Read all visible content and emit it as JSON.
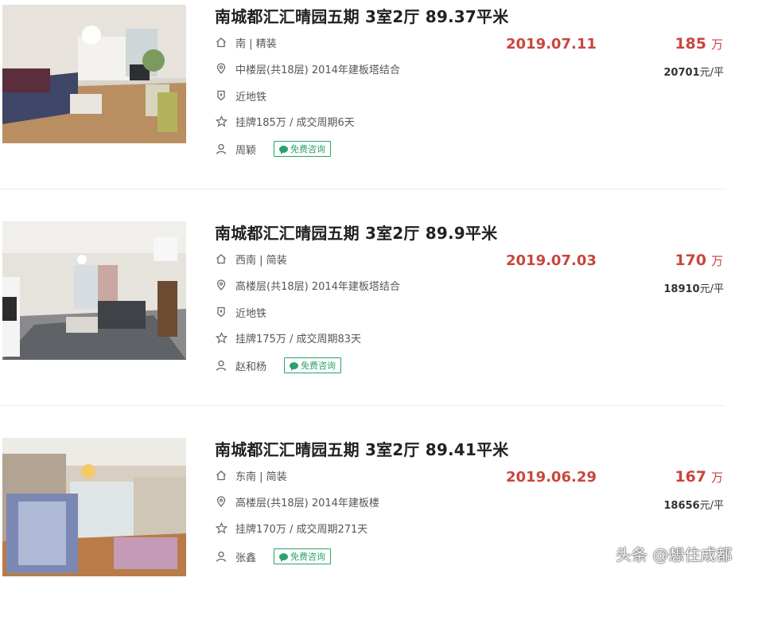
{
  "listings": [
    {
      "title": "南城都汇汇晴园五期 3室2厅 89.37平米",
      "orientation_decor": "南 | 精装",
      "floor_info": "中楼层(共18层) 2014年建板塔结合",
      "tag": "近地铁",
      "listing_info": "挂牌185万 / 成交周期6天",
      "agent": "周颖",
      "consult_label": "免费咨询",
      "date": "2019.07.11",
      "price": "185",
      "price_unit": "万",
      "unit_price": "20701",
      "unit_price_suffix": "元/平"
    },
    {
      "title": "南城都汇汇晴园五期 3室2厅 89.9平米",
      "orientation_decor": "西南 | 简装",
      "floor_info": "高楼层(共18层) 2014年建板塔结合",
      "tag": "近地铁",
      "listing_info": "挂牌175万 / 成交周期83天",
      "agent": "赵和杨",
      "consult_label": "免费咨询",
      "date": "2019.07.03",
      "price": "170",
      "price_unit": "万",
      "unit_price": "18910",
      "unit_price_suffix": "元/平"
    },
    {
      "title": "南城都汇汇晴园五期 3室2厅 89.41平米",
      "orientation_decor": "东南 | 简装",
      "floor_info": "高楼层(共18层) 2014年建板楼",
      "listing_info": "挂牌170万 / 成交周期271天",
      "agent": "张鑫",
      "consult_label": "免费咨询",
      "date": "2019.06.29",
      "price": "167",
      "price_unit": "万",
      "unit_price": "18656",
      "unit_price_suffix": "元/平"
    }
  ],
  "watermark": "头条 @想住成都",
  "colors": {
    "accent_red": "#c9463d",
    "consult_green": "#29a36a",
    "icon_gray": "#666666"
  },
  "icons": [
    "house-icon",
    "location-pin-icon",
    "shield-icon",
    "star-icon",
    "person-icon",
    "chat-icon"
  ]
}
